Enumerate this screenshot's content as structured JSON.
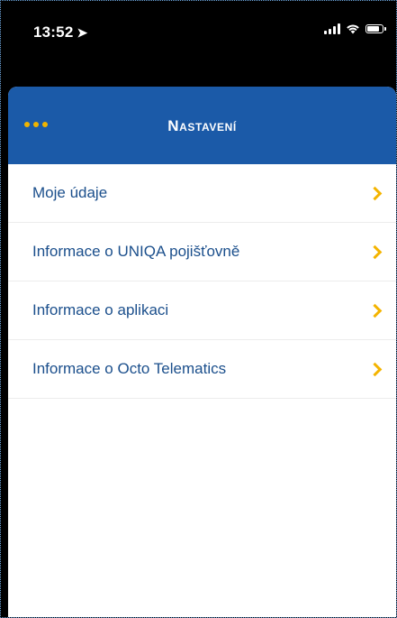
{
  "status_bar": {
    "time": "13:52",
    "location_glyph": "➤",
    "icons": [
      "cellular-signal-icon",
      "wifi-icon",
      "battery-icon"
    ]
  },
  "nav": {
    "title": "Nastavení",
    "menu_icon": "more-dots-icon",
    "accent_color": "#1b5aa8",
    "dots_color": "#f0b400"
  },
  "menu": {
    "items": [
      {
        "label": "Moje údaje"
      },
      {
        "label": "Informace o UNIQA pojišťovně"
      },
      {
        "label": "Informace o aplikaci"
      },
      {
        "label": "Informace o Octo Telematics"
      }
    ],
    "chevron_icon": "chevron-right-icon",
    "chevron_color": "#f4b400",
    "label_color": "#1b4f8c"
  }
}
